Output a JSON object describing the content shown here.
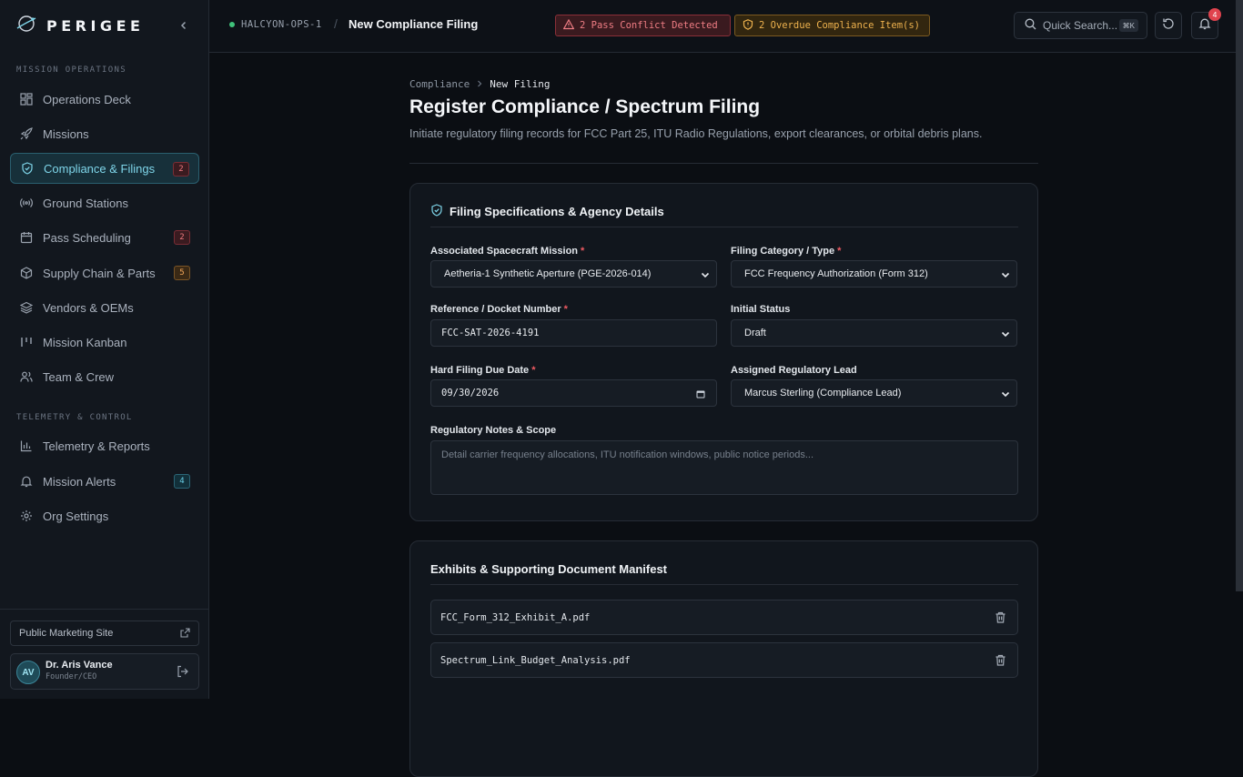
{
  "sidebar": {
    "brand": "PERIGEE",
    "sections": {
      "mission_ops": "MISSION OPERATIONS",
      "telemetry": "TELEMETRY & CONTROL"
    },
    "items": [
      {
        "label": "Operations Deck"
      },
      {
        "label": "Missions"
      },
      {
        "label": "Compliance & Filings",
        "badge": "2",
        "active": true
      },
      {
        "label": "Ground Stations"
      },
      {
        "label": "Pass Scheduling",
        "badge": "2"
      },
      {
        "label": "Supply Chain & Parts",
        "badge": "5"
      },
      {
        "label": "Vendors & OEMs"
      },
      {
        "label": "Mission Kanban"
      },
      {
        "label": "Team & Crew"
      },
      {
        "label": "Telemetry & Reports"
      },
      {
        "label": "Mission Alerts",
        "badge": "4"
      },
      {
        "label": "Org Settings"
      }
    ],
    "public_site": "Public Marketing Site",
    "user": {
      "initials": "AV",
      "name": "Dr. Aris Vance",
      "role": "Founder/CEO"
    }
  },
  "topbar": {
    "workspace": "HALCYON-OPS-1",
    "separator": "/",
    "page": "New Compliance Filing",
    "alert_conflict": "2 Pass Conflict Detected",
    "alert_overdue": "2 Overdue Compliance Item(s)",
    "search_label": "Quick Search...",
    "search_shortcut": "⌘K",
    "notification_count": "4"
  },
  "main": {
    "breadcrumb": {
      "parent": "Compliance",
      "current": "New Filing"
    },
    "title": "Register Compliance / Spectrum Filing",
    "subtitle": "Initiate regulatory filing records for FCC Part 25, ITU Radio Regulations, export clearances, or orbital debris plans.",
    "spec_card": {
      "title": "Filing Specifications & Agency Details",
      "mission_label": "Associated Spacecraft Mission",
      "mission_value": "Aetheria-1 Synthetic Aperture (PGE-2026-014)",
      "category_label": "Filing Category / Type",
      "category_value": "FCC Frequency Authorization (Form 312)",
      "docket_label": "Reference / Docket Number",
      "docket_value": "FCC-SAT-2026-4191",
      "status_label": "Initial Status",
      "status_value": "Draft",
      "due_label": "Hard Filing Due Date",
      "due_value": "09/30/2026",
      "lead_label": "Assigned Regulatory Lead",
      "lead_value": "Marcus Sterling (Compliance Lead)",
      "notes_label": "Regulatory Notes & Scope",
      "notes_placeholder": "Detail carrier frequency allocations, ITU notification windows, public notice periods..."
    },
    "docs_card": {
      "title": "Exhibits & Supporting Document Manifest",
      "files": [
        "FCC_Form_312_Exhibit_A.pdf",
        "Spectrum_Link_Budget_Analysis.pdf"
      ]
    }
  },
  "colors": {
    "accent": "#7fd6ea",
    "danger": "#ef7d84",
    "warning": "#eeb24e",
    "background": "#0b0e13"
  }
}
